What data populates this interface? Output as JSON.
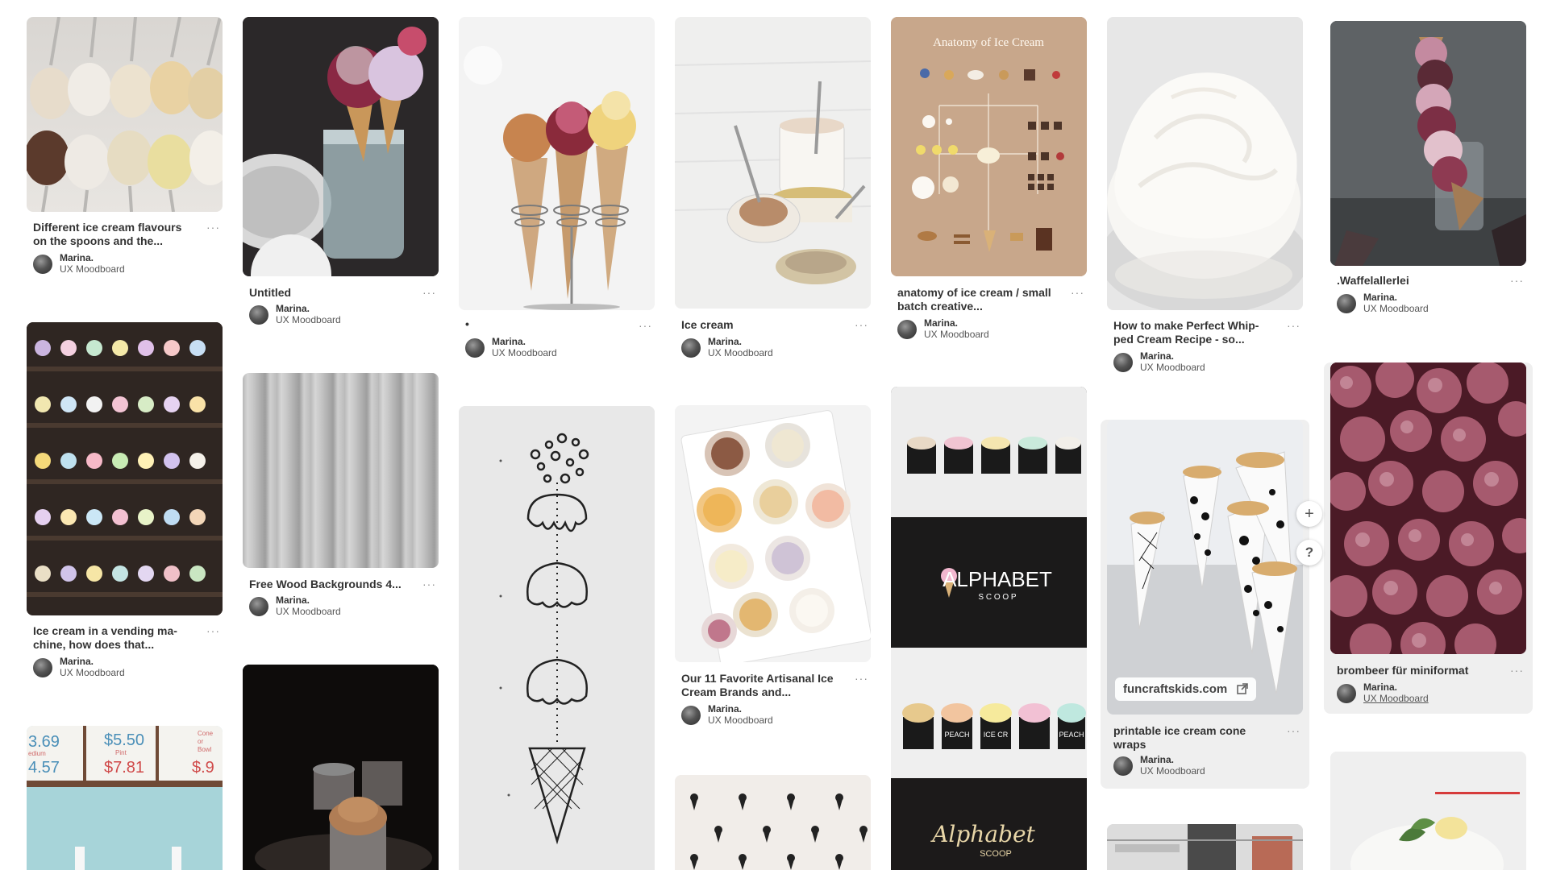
{
  "pins": [
    {
      "id": "flavours",
      "title_line1": "Different ice cream flavours",
      "title_line2": "on the spoons and the...",
      "pinner": "Marina.",
      "board": "UX Moodboard"
    },
    {
      "id": "untitled",
      "title_line1": "Untitled",
      "pinner": "Marina.",
      "board": "UX Moodboard"
    },
    {
      "id": "dot",
      "title_line1": "•",
      "pinner": "Marina.",
      "board": "UX Moodboard"
    },
    {
      "id": "icecream",
      "title_line1": "Ice cream",
      "pinner": "Marina.",
      "board": "UX Moodboard"
    },
    {
      "id": "anatomy",
      "title_line1": "anatomy of ice cream / small",
      "title_line2": "batch creative...",
      "pinner": "Marina.",
      "board": "UX Moodboard",
      "image_heading": "Anatomy of Ice Cream"
    },
    {
      "id": "whipped",
      "title_line1": "How to make Perfect Whip-",
      "title_line2": "ped Cream Recipe - so...",
      "pinner": "Marina.",
      "board": "UX Moodboard"
    },
    {
      "id": "waffel",
      "title_line1": ".Waffelallerlei",
      "pinner": "Marina.",
      "board": "UX Moodboard"
    },
    {
      "id": "vending",
      "title_line1": "Ice cream in a vending ma-",
      "title_line2": "chine, how does that...",
      "pinner": "Marina.",
      "board": "UX Moodboard"
    },
    {
      "id": "wood",
      "title_line1": "Free Wood Backgrounds 4...",
      "pinner": "Marina.",
      "board": "UX Moodboard"
    },
    {
      "id": "artisanal",
      "title_line1": "Our 11 Favorite Artisanal Ice",
      "title_line2": "Cream Brands and...",
      "pinner": "Marina.",
      "board": "UX Moodboard"
    },
    {
      "id": "printable",
      "title_line1": "printable ice cream cone",
      "title_line2": "wraps",
      "pinner": "Marina.",
      "board": "UX Moodboard",
      "link": "funcraftskids.com"
    },
    {
      "id": "brombeer",
      "title_line1": "brombeer für miniformat",
      "pinner": "Marina.",
      "board": "UX Moodboard"
    }
  ],
  "alphabet": {
    "logo_top": "ALPHABET",
    "logo_sub": "S C O O P",
    "logo_script": "Alphabet",
    "logo_script_sub": "SCOOP",
    "cup_labels": [
      "PEACH",
      "ICE CR",
      "PEACH"
    ]
  },
  "prices": {
    "p1": "3.69",
    "p2": "$5.50",
    "p3": "$7.81",
    "p4": "$.9",
    "p5": "4.57",
    "label1": "edium",
    "label2": "Pint",
    "label3": "Cone",
    "label4": "or",
    "label5": "Bowl"
  },
  "more_icon": "···",
  "float_buttons": {
    "add": "+",
    "help": "?"
  },
  "colors": {
    "background": "#ffffff",
    "hover_card": "#efefef",
    "text": "#333333",
    "muted": "#8e8e8e"
  }
}
